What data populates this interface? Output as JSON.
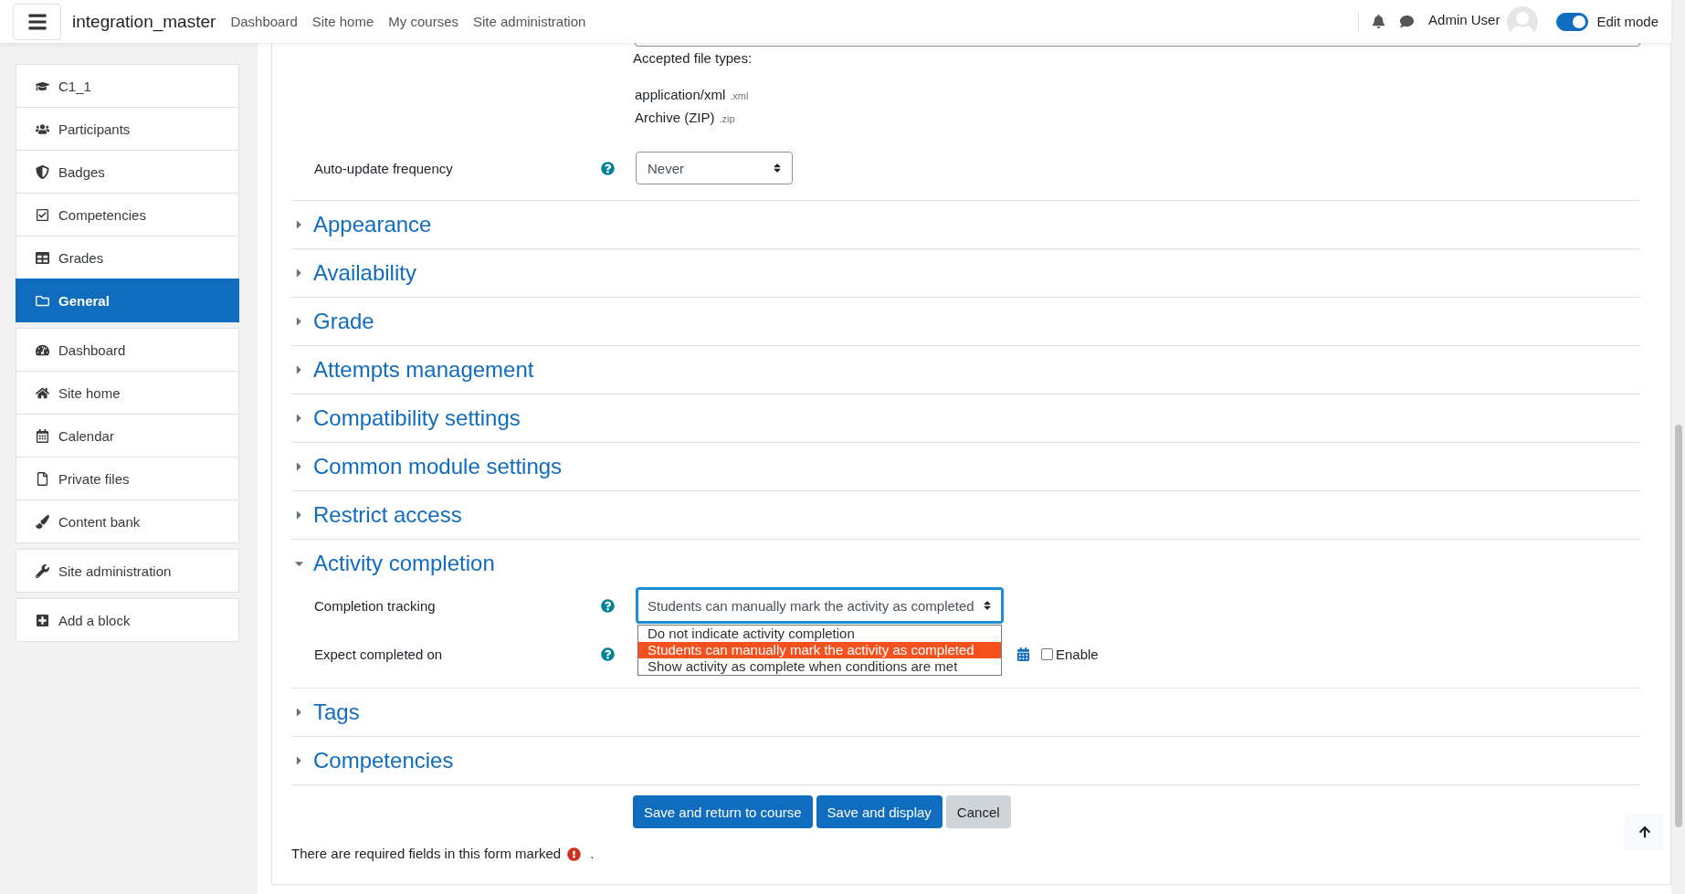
{
  "navbar": {
    "site_name": "integration_master",
    "links": [
      "Dashboard",
      "Site home",
      "My courses",
      "Site administration"
    ],
    "user_name": "Admin User",
    "edit_mode": {
      "label": "Edit mode",
      "on": true
    }
  },
  "sidebar": {
    "groups": [
      {
        "items": [
          {
            "label": "C1_1",
            "selected": false
          },
          {
            "label": "Participants",
            "selected": false
          },
          {
            "label": "Badges",
            "selected": false
          },
          {
            "label": "Competencies",
            "selected": false
          },
          {
            "label": "Grades",
            "selected": false
          },
          {
            "label": "General",
            "selected": true
          }
        ]
      },
      {
        "items": [
          {
            "label": "Dashboard",
            "selected": false
          },
          {
            "label": "Site home",
            "selected": false
          },
          {
            "label": "Calendar",
            "selected": false
          },
          {
            "label": "Private files",
            "selected": false
          },
          {
            "label": "Content bank",
            "selected": false
          }
        ]
      },
      {
        "items": [
          {
            "label": "Site administration",
            "selected": false
          }
        ]
      },
      {
        "items": [
          {
            "label": "Add a block",
            "selected": false
          }
        ]
      }
    ]
  },
  "form": {
    "accepted_label": "Accepted file types:",
    "file_types": [
      {
        "name": "application/xml",
        "ext": ".xml"
      },
      {
        "name": "Archive (ZIP)",
        "ext": ".zip"
      }
    ],
    "auto_update": {
      "label": "Auto-update frequency",
      "value": "Never"
    },
    "sections": [
      {
        "title": "Appearance",
        "expanded": false
      },
      {
        "title": "Availability",
        "expanded": false
      },
      {
        "title": "Grade",
        "expanded": false
      },
      {
        "title": "Attempts management",
        "expanded": false
      },
      {
        "title": "Compatibility settings",
        "expanded": false
      },
      {
        "title": "Common module settings",
        "expanded": false
      },
      {
        "title": "Restrict access",
        "expanded": false
      },
      {
        "title": "Activity completion",
        "expanded": true,
        "fields": [
          {
            "kind": "select",
            "label": "Completion tracking",
            "value": "Students can manually mark the activity as completed",
            "open": true,
            "options": [
              {
                "label": "Do not indicate activity completion",
                "selected": false
              },
              {
                "label": "Students can manually mark the activity as completed",
                "selected": true
              },
              {
                "label": "Show activity as complete when conditions are met",
                "selected": false
              }
            ]
          },
          {
            "kind": "date",
            "label": "Expect completed on",
            "checkbox_label": "Enable",
            "checked": false
          }
        ]
      },
      {
        "title": "Tags",
        "expanded": false
      },
      {
        "title": "Competencies",
        "expanded": false
      }
    ],
    "buttons": [
      {
        "label": "Save and return to course",
        "kind": "primary"
      },
      {
        "label": "Save and display",
        "kind": "primary"
      },
      {
        "label": "Cancel",
        "kind": "secondary"
      }
    ],
    "required_note": {
      "text": "There are required fields in this form marked",
      "end": "."
    }
  }
}
